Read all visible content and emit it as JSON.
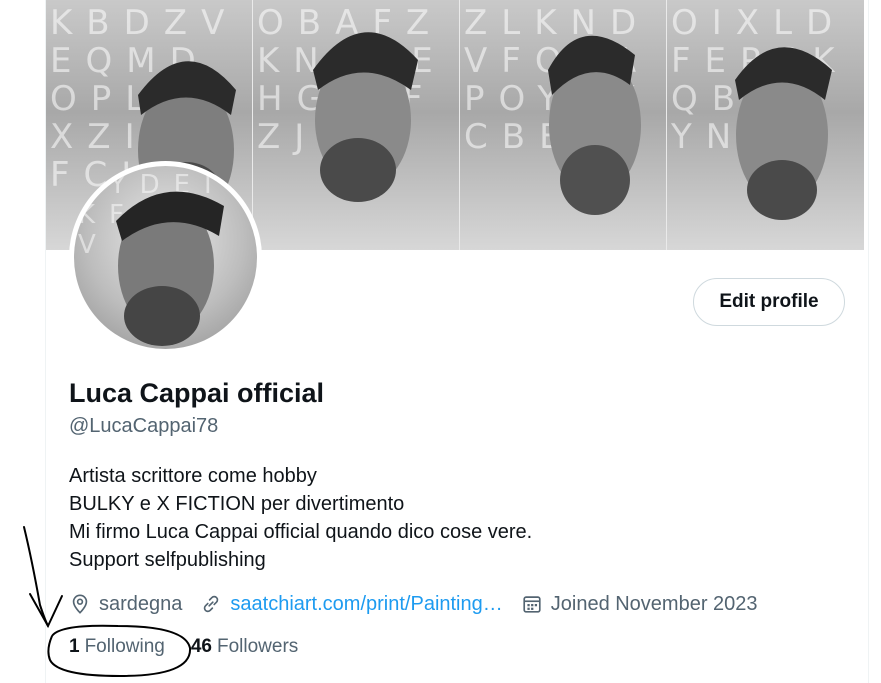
{
  "profile": {
    "display_name": "Luca Cappai official",
    "handle": "@LucaCappai78",
    "bio_lines": [
      "Artista scrittore come hobby",
      "BULKY e X FICTION per divertimento",
      "Mi firmo Luca Cappai official quando dico cose vere.",
      "Support selfpublishing"
    ],
    "location": "sardegna",
    "website": "saatchiart.com/print/Painting…",
    "joined": "Joined November 2023",
    "edit_button_label": "Edit profile"
  },
  "stats": {
    "following_count": "1",
    "following_label": "Following",
    "followers_count": "46",
    "followers_label": "Followers"
  },
  "icons": {
    "location": "location-pin-icon",
    "website": "link-icon",
    "joined": "calendar-icon"
  },
  "colors": {
    "text_primary": "#0f1419",
    "text_secondary": "#536471",
    "link": "#1d9bf0",
    "border": "#cfd9de"
  }
}
